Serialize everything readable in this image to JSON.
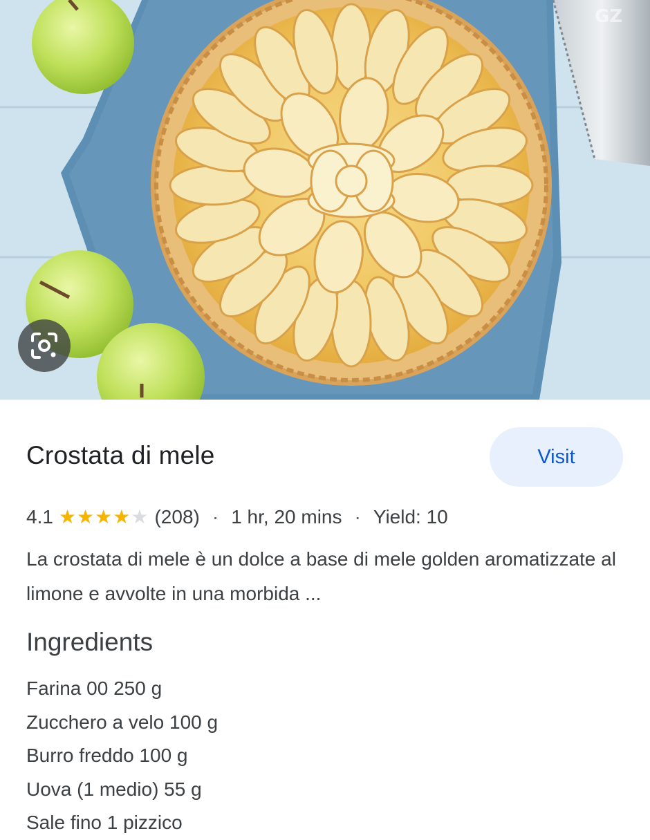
{
  "recipe": {
    "title": "Crostata di mele",
    "visit_label": "Visit",
    "rating": "4.1",
    "stars_filled": 4,
    "stars_total": 5,
    "review_count": "(208)",
    "separator": "·",
    "time": "1 hr, 20 mins",
    "yield": "Yield: 10",
    "description": "La crostata di mele è un dolce a base di mele golden aromatizzate al limone e avvolte in una morbida ...",
    "ingredients_heading": "Ingredients",
    "ingredients": [
      "Farina 00 250 g",
      "Zucchero a velo 100 g",
      "Burro freddo 100 g",
      "Uova (1 medio) 55 g",
      "Sale fino 1 pizzico"
    ]
  },
  "icons": {
    "lens": "camera-lens-icon",
    "star": "star-icon"
  },
  "colors": {
    "accent_blue": "#0b57d0",
    "visit_bg": "#e9f0fd",
    "star_gold": "#f5b400",
    "star_empty": "#dadce0"
  }
}
